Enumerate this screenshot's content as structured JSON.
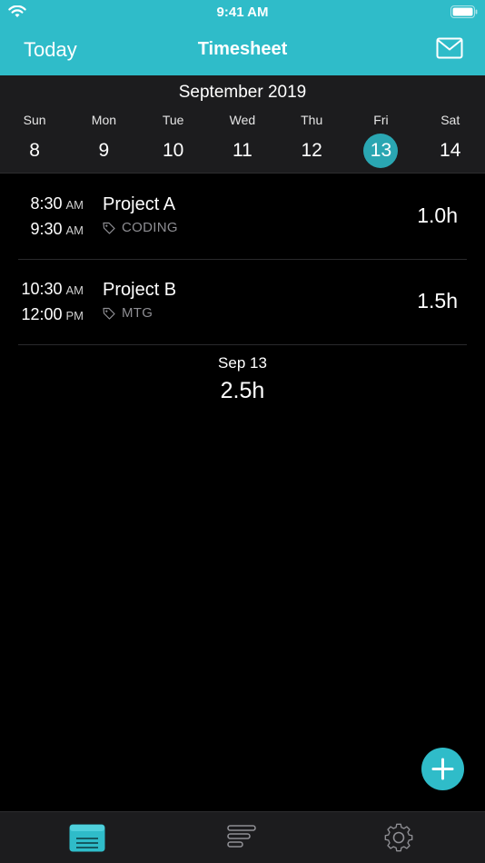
{
  "status_bar": {
    "time": "9:41 AM",
    "wifi_icon": "wifi-icon",
    "battery_icon": "battery-icon"
  },
  "nav": {
    "left_label": "Today",
    "title": "Timesheet",
    "right_icon": "mail-icon"
  },
  "week": {
    "month_label": "September 2019",
    "days": [
      {
        "name": "Sun",
        "num": "8"
      },
      {
        "name": "Mon",
        "num": "9"
      },
      {
        "name": "Tue",
        "num": "10"
      },
      {
        "name": "Wed",
        "num": "11"
      },
      {
        "name": "Thu",
        "num": "12"
      },
      {
        "name": "Fri",
        "num": "13",
        "selected": true
      },
      {
        "name": "Sat",
        "num": "14"
      }
    ]
  },
  "entries": [
    {
      "start": "8:30",
      "start_ampm": "AM",
      "end": "9:30",
      "end_ampm": "AM",
      "project": "Project A",
      "tag": "CODING",
      "duration": "1.0h"
    },
    {
      "start": "10:30",
      "start_ampm": "AM",
      "end": "12:00",
      "end_ampm": "PM",
      "project": "Project B",
      "tag": "MTG",
      "duration": "1.5h"
    }
  ],
  "summary": {
    "date": "Sep 13",
    "total": "2.5h"
  },
  "fab": {
    "icon": "plus-icon"
  },
  "tabs": [
    {
      "icon": "timesheet-icon",
      "active": true
    },
    {
      "icon": "reports-icon"
    },
    {
      "icon": "settings-gear-icon"
    }
  ],
  "colors": {
    "accent": "#2fbcc9",
    "selected_day": "#2aa6b2",
    "background": "#000000",
    "panel": "#1c1c1e",
    "tag_gray": "#8e8e93"
  }
}
